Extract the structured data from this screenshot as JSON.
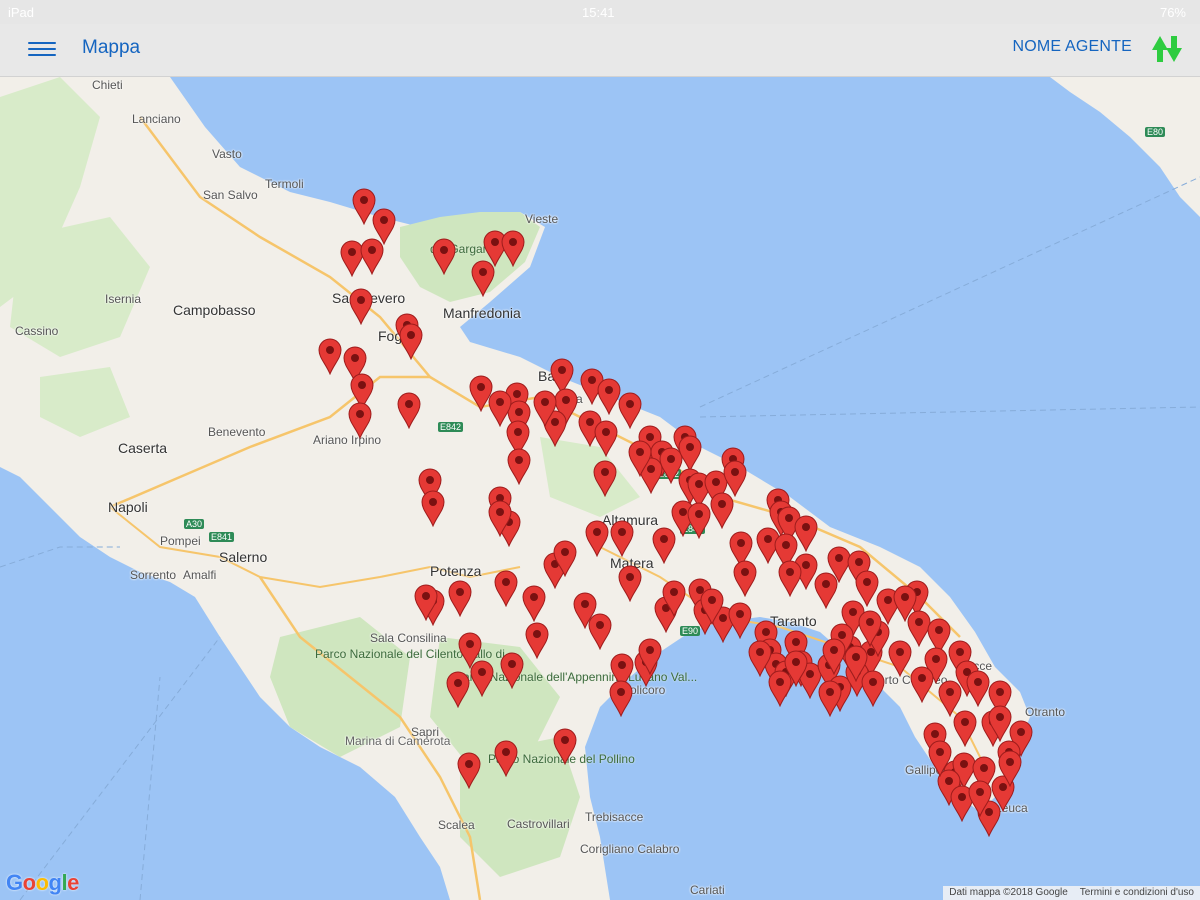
{
  "status_bar": {
    "device": "iPad",
    "time": "15:41",
    "battery": "76%"
  },
  "app_bar": {
    "title": "Mappa",
    "agent_label": "NOME AGENTE",
    "menu_icon": "hamburger-menu-icon",
    "sync_icon": "sync-arrows-icon"
  },
  "colors": {
    "accent": "#1565c0",
    "sync": "#2ecc40",
    "pin": "#e53935",
    "sea": "#9cc4f5",
    "land": "#f2efe9",
    "park": "#cfe6bf"
  },
  "map": {
    "places": [
      {
        "name": "Chieti"
      },
      {
        "name": "Lanciano"
      },
      {
        "name": "Vasto"
      },
      {
        "name": "Termoli"
      },
      {
        "name": "San Salvo"
      },
      {
        "name": "Vieste"
      },
      {
        "name": "Manfredonia"
      },
      {
        "name": "San Severo"
      },
      {
        "name": "Foggia"
      },
      {
        "name": "Isernia"
      },
      {
        "name": "Campobasso"
      },
      {
        "name": "Cassino"
      },
      {
        "name": "Benevento"
      },
      {
        "name": "Ariano Irpino"
      },
      {
        "name": "Caserta"
      },
      {
        "name": "Napoli"
      },
      {
        "name": "Pompei"
      },
      {
        "name": "Salerno"
      },
      {
        "name": "Sorrento"
      },
      {
        "name": "Amalfi"
      },
      {
        "name": "Potenza"
      },
      {
        "name": "Altamura"
      },
      {
        "name": "Matera"
      },
      {
        "name": "Taranto"
      },
      {
        "name": "Policoro"
      },
      {
        "name": "Sala Consilina"
      },
      {
        "name": "Marina di Camerota"
      },
      {
        "name": "Sapri"
      },
      {
        "name": "Trebisacce"
      },
      {
        "name": "Scalea"
      },
      {
        "name": "Castrovillari"
      },
      {
        "name": "Corigliano Calabro"
      },
      {
        "name": "Cariati"
      },
      {
        "name": "Gallipoli"
      },
      {
        "name": "Porto Cesareo"
      },
      {
        "name": "Otranto"
      },
      {
        "name": "Leuca"
      },
      {
        "name": "Lecce"
      },
      {
        "name": "Bari"
      },
      {
        "name": "Andria"
      }
    ],
    "regions": [
      {
        "name": "Parco Nazionale del Cilento Vallo di..."
      },
      {
        "name": "Parco Nazionale dell'Appennino Lucano Val..."
      },
      {
        "name": "Parco Nazionale del Pollino"
      },
      {
        "name": "del Gargano"
      }
    ],
    "highways": [
      "E842",
      "E842",
      "E843",
      "E90",
      "E841",
      "A30",
      "E80"
    ],
    "pin_count": 150,
    "google_logo": "Google",
    "attribution": {
      "data": "Dati mappa ©2018 Google",
      "terms": "Termini e condizioni d'uso"
    }
  }
}
